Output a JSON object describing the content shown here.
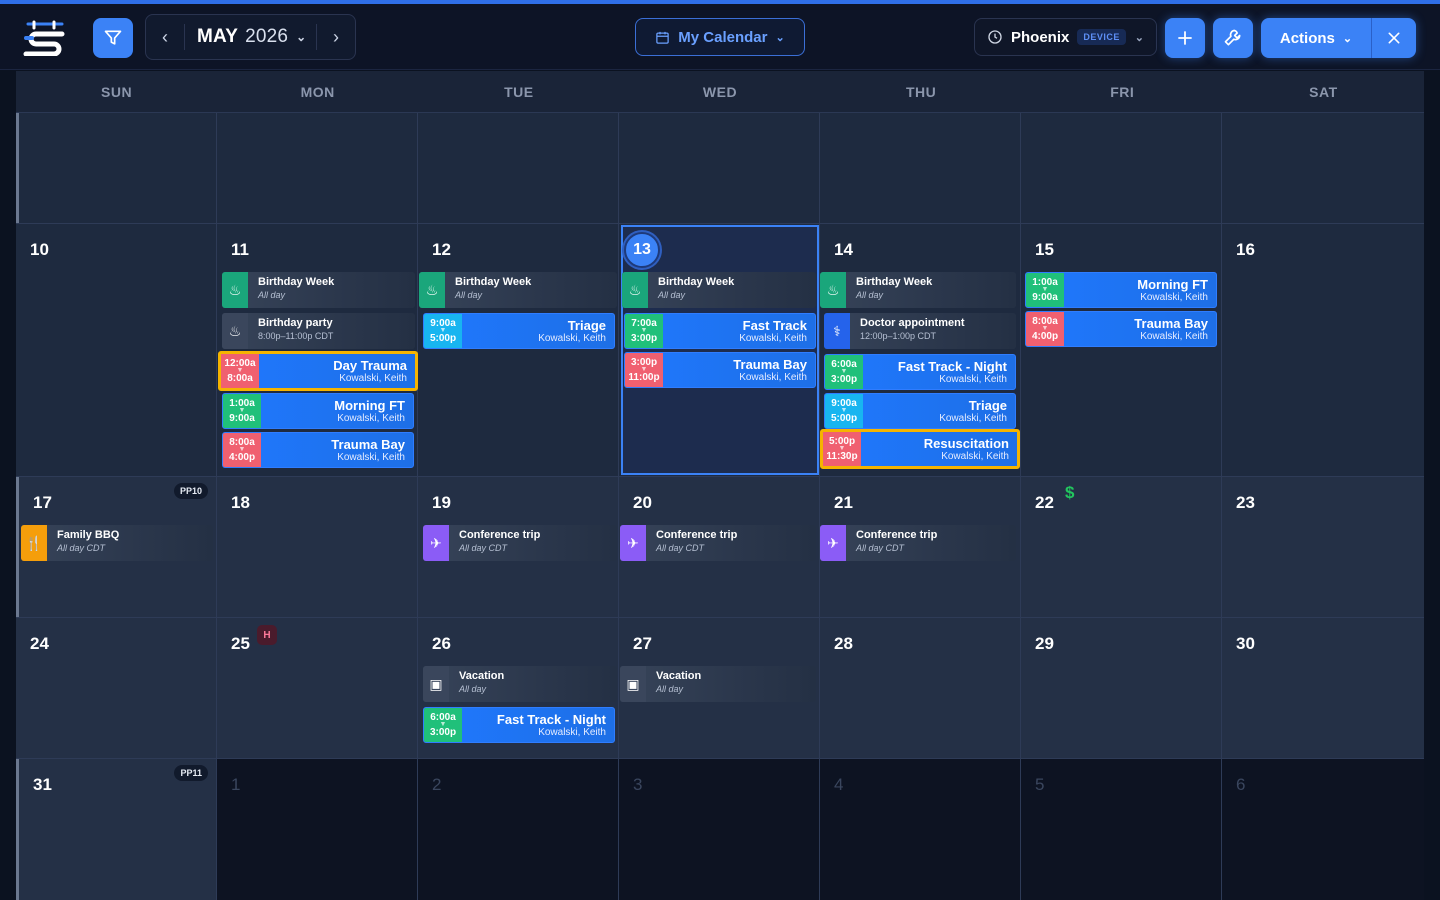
{
  "toolbar": {
    "month": "MAY",
    "year": "2026",
    "calendar": "My Calendar",
    "tz": "Phoenix",
    "tz_badge": "DEVICE",
    "actions": "Actions"
  },
  "days_of_week": [
    "SUN",
    "MON",
    "TUE",
    "WED",
    "THU",
    "FRI",
    "SAT"
  ],
  "weeks": [
    {
      "days": [
        "",
        "",
        "",
        "",
        "",
        "",
        ""
      ]
    },
    {
      "days": [
        "10",
        "11",
        "12",
        "13",
        "14",
        "15",
        "16"
      ]
    },
    {
      "days": [
        "17",
        "18",
        "19",
        "20",
        "21",
        "22",
        "23"
      ]
    },
    {
      "days": [
        "24",
        "25",
        "26",
        "27",
        "28",
        "29",
        "30"
      ]
    },
    {
      "days": [
        "31",
        "1",
        "2",
        "3",
        "4",
        "5",
        "6"
      ]
    }
  ],
  "markers": {
    "pp10": "PP10",
    "pp11": "PP11",
    "holiday": "H",
    "pay": "$"
  },
  "events": {
    "bw": {
      "title": "Birthday Week",
      "sub": "All day"
    },
    "bp": {
      "title": "Birthday party",
      "sub": "8:00p–11:00p CDT"
    },
    "doc": {
      "title": "Doctor appointment",
      "sub": "12:00p–1:00p CDT"
    },
    "bbq": {
      "title": "Family BBQ",
      "sub": "All day CDT"
    },
    "conf": {
      "title": "Conference trip",
      "sub": "All day CDT"
    },
    "vac": {
      "title": "Vacation",
      "sub": "All day"
    }
  },
  "shifts": {
    "who": "Kowalski, Keith",
    "day_trauma": {
      "name": "Day Trauma",
      "start": "12:00a",
      "end": "8:00a"
    },
    "morning_ft": {
      "name": "Morning FT",
      "start": "1:00a",
      "end": "9:00a"
    },
    "trauma_bay_8": {
      "name": "Trauma Bay",
      "start": "8:00a",
      "end": "4:00p"
    },
    "triage_9": {
      "name": "Triage",
      "start": "9:00a",
      "end": "5:00p"
    },
    "fast_track": {
      "name": "Fast Track",
      "start": "7:00a",
      "end": "3:00p"
    },
    "trauma_bay_3": {
      "name": "Trauma Bay",
      "start": "3:00p",
      "end": "11:00p"
    },
    "ftn": {
      "name": "Fast Track - Night",
      "start": "6:00a",
      "end": "3:00p"
    },
    "resus": {
      "name": "Resuscitation",
      "start": "5:00p",
      "end": "11:30p"
    }
  }
}
